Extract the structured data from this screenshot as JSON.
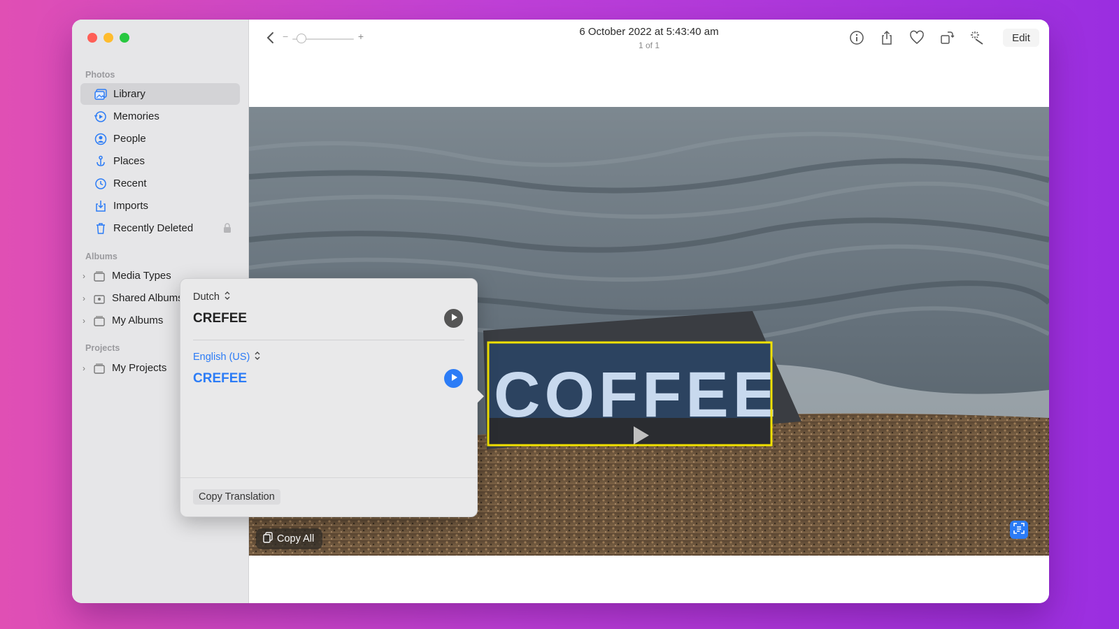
{
  "sidebar": {
    "photos_label": "Photos",
    "items": [
      {
        "label": "Library",
        "icon": "library-icon",
        "selected": true
      },
      {
        "label": "Memories",
        "icon": "memories-icon"
      },
      {
        "label": "People",
        "icon": "people-icon"
      },
      {
        "label": "Places",
        "icon": "places-icon"
      },
      {
        "label": "Recent",
        "icon": "clock-icon"
      },
      {
        "label": "Imports",
        "icon": "imports-icon"
      },
      {
        "label": "Recently Deleted",
        "icon": "trash-icon",
        "locked": true
      }
    ],
    "albums_label": "Albums",
    "albums": [
      {
        "label": "Media Types",
        "icon": "folder-icon"
      },
      {
        "label": "Shared Albums",
        "icon": "shared-folder-icon"
      },
      {
        "label": "My Albums",
        "icon": "folder-icon"
      }
    ],
    "projects_label": "Projects",
    "projects": [
      {
        "label": "My Projects",
        "icon": "folder-icon"
      }
    ]
  },
  "toolbar": {
    "title": "6 October 2022 at 5:43:40 am",
    "subtitle": "1 of 1",
    "zoom_minus": "−",
    "zoom_plus": "+",
    "edit_label": "Edit",
    "icons": [
      "info-icon",
      "share-icon",
      "heart-icon",
      "rotate-icon",
      "magic-wand-icon"
    ]
  },
  "translation": {
    "source_language": "Dutch",
    "source_text": "CREFEE",
    "target_language": "English (US)",
    "target_text": "CREFEE",
    "copy_translation_label": "Copy Translation"
  },
  "photo": {
    "sign_text": "COFFEE",
    "copy_all_label": "Copy All"
  },
  "colors": {
    "accent": "#2c7cf6",
    "highlight": "#f2e200",
    "sidebar_bg": "#e6e6e8"
  }
}
